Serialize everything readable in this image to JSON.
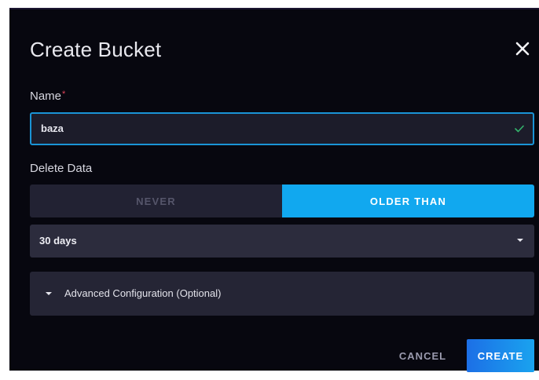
{
  "dialog": {
    "title": "Create Bucket",
    "close_icon": "close-icon"
  },
  "name_field": {
    "label": "Name",
    "required_marker": "*",
    "value": "baza",
    "valid_icon": "check-icon"
  },
  "delete_data": {
    "label": "Delete Data",
    "options": [
      "NEVER",
      "OLDER THAN"
    ],
    "selected": "OLDER THAN"
  },
  "retention": {
    "value": "30 days",
    "icon": "caret-down-icon"
  },
  "advanced": {
    "label": "Advanced Configuration (Optional)",
    "icon": "caret-right-icon"
  },
  "footer": {
    "cancel_label": "CANCEL",
    "create_label": "CREATE"
  },
  "colors": {
    "background": "#07070f",
    "accent": "#11a8ef",
    "input_border": "#1a94d6",
    "required": "#e3435a",
    "valid_check": "#34b46c"
  }
}
